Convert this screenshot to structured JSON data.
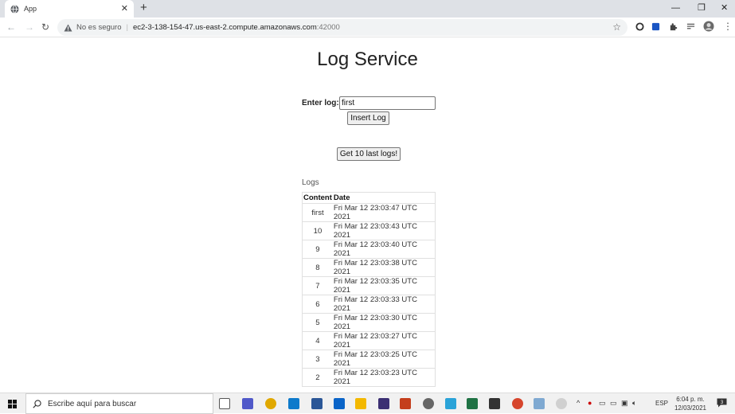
{
  "browser": {
    "tab_title": "App",
    "url_insecure_label": "No es seguro",
    "url_host": "ec2-3-138-154-47.us-east-2.compute.amazonaws.com",
    "url_port": ":42000"
  },
  "page": {
    "title": "Log Service",
    "log_label": "Enter log:",
    "log_input_value": "first",
    "insert_button": "Insert Log",
    "get_button": "Get 10 last logs!",
    "logs_heading": "Logs",
    "table": {
      "headers": [
        "Content",
        "Date"
      ],
      "rows": [
        {
          "content": "first",
          "date": "Fri Mar 12 23:03:47 UTC 2021"
        },
        {
          "content": "10",
          "date": "Fri Mar 12 23:03:43 UTC 2021"
        },
        {
          "content": "9",
          "date": "Fri Mar 12 23:03:40 UTC 2021"
        },
        {
          "content": "8",
          "date": "Fri Mar 12 23:03:38 UTC 2021"
        },
        {
          "content": "7",
          "date": "Fri Mar 12 23:03:35 UTC 2021"
        },
        {
          "content": "6",
          "date": "Fri Mar 12 23:03:33 UTC 2021"
        },
        {
          "content": "5",
          "date": "Fri Mar 12 23:03:30 UTC 2021"
        },
        {
          "content": "4",
          "date": "Fri Mar 12 23:03:27 UTC 2021"
        },
        {
          "content": "3",
          "date": "Fri Mar 12 23:03:25 UTC 2021"
        },
        {
          "content": "2",
          "date": "Fri Mar 12 23:03:23 UTC 2021"
        }
      ]
    }
  },
  "taskbar": {
    "search_placeholder": "Escribe aquí para buscar",
    "language": "ESP",
    "time": "6:04 p. m.",
    "date": "12/03/2021",
    "notification_count": "3"
  }
}
